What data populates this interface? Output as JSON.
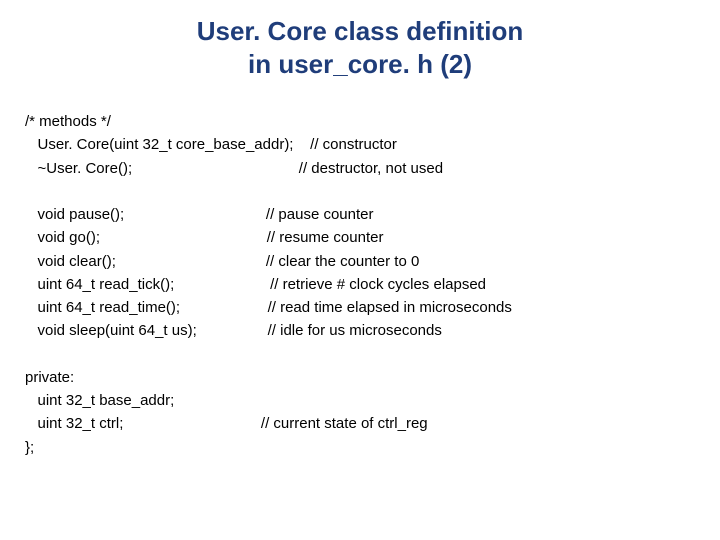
{
  "title_line1": "User. Core class definition",
  "title_line2": "in user_core. h (2)",
  "code_text": "/* methods */\n   User. Core(uint 32_t core_base_addr);    // constructor\n   ~User. Core();                                        // destructor, not used\n\n   void pause();                                  // pause counter\n   void go();                                        // resume counter\n   void clear();                                    // clear the counter to 0\n   uint 64_t read_tick();                       // retrieve # clock cycles elapsed\n   uint 64_t read_time();                     // read time elapsed in microseconds\n   void sleep(uint 64_t us);                 // idle for us microseconds\n\nprivate:\n   uint 32_t base_addr;\n   uint 32_t ctrl;                                 // current state of ctrl_reg\n};"
}
